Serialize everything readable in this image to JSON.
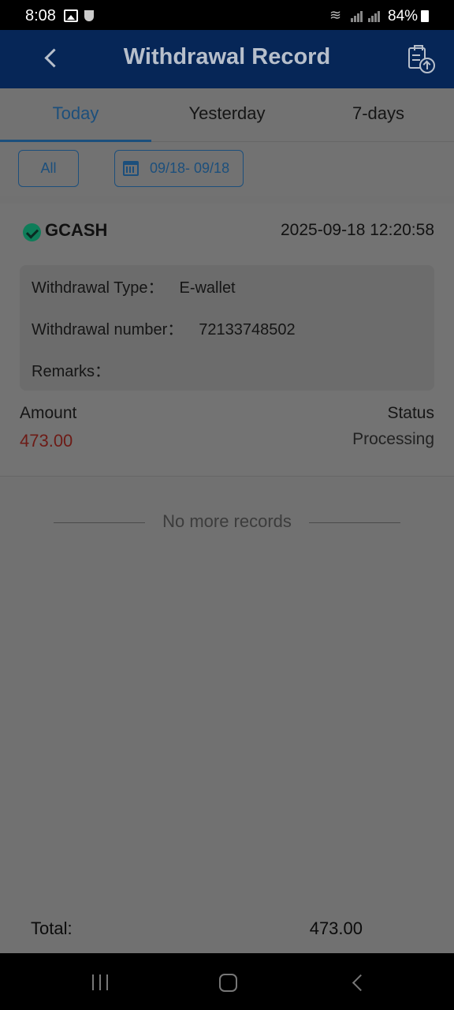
{
  "status_bar": {
    "time": "8:08",
    "battery": "84%"
  },
  "header": {
    "title": "Withdrawal Record",
    "back_icon": "chevron-left-icon",
    "action_icon": "clipboard-upload-icon"
  },
  "tabs": [
    {
      "label": "Today",
      "active": true
    },
    {
      "label": "Yesterday",
      "active": false
    },
    {
      "label": "7-days",
      "active": false
    }
  ],
  "filters": {
    "type_label": "All",
    "date_range": "09/18- 09/18"
  },
  "record": {
    "channel": "GCASH",
    "datetime": "2025-09-18 12:20:58",
    "withdrawal_type_label": "Withdrawal Type：",
    "withdrawal_type_value": "E-wallet",
    "withdrawal_number_label": "Withdrawal number：",
    "withdrawal_number_value": "72133748502",
    "remarks_label": "Remarks：",
    "remarks_value": "",
    "amount_label": "Amount",
    "amount_value": "473.00",
    "status_label": "Status",
    "status_value": "Processing"
  },
  "list_footer": "No more records",
  "total": {
    "label": "Total:",
    "value": "473.00"
  },
  "colors": {
    "header_bg": "#062657",
    "accent": "#1c4f7c",
    "amount": "#6d1b16",
    "overlay_bg": "#717171"
  }
}
